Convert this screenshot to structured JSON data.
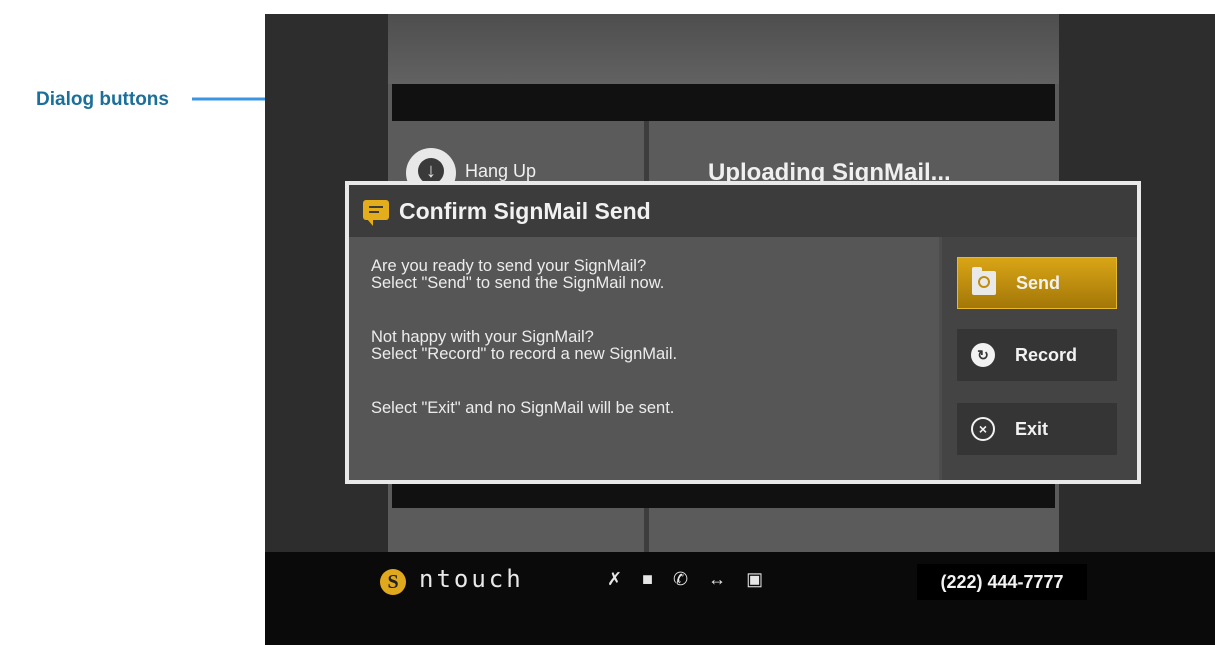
{
  "annotation": {
    "label": "Dialog buttons"
  },
  "background": {
    "left_button_label": "Hang Up",
    "status_text": "Uploading SignMail..."
  },
  "dialog": {
    "title": "Confirm SignMail Send",
    "messages": [
      "Are you ready to send your SignMail?",
      "Select \"Send\" to send the SignMail now.",
      "Not happy with your SignMail?",
      "Select \"Record\" to record a new SignMail.",
      "Select \"Exit\" and no SignMail will be sent."
    ],
    "buttons": {
      "send": "Send",
      "record": "Record",
      "exit": "Exit"
    }
  },
  "footer": {
    "brand": "ntouch",
    "brand_mark": "S",
    "phone_number": "(222) 444-7777",
    "status_icons": [
      "mic-muted-icon",
      "video-camera-icon",
      "phone-icon",
      "connection-icon",
      "display-icon"
    ]
  },
  "colors": {
    "accent": "#e4ad1b",
    "callout": "#3a95e0",
    "callout_text": "#1b6f9b"
  }
}
